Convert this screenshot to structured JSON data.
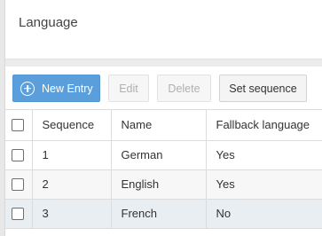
{
  "header": {
    "title": "Language"
  },
  "toolbar": {
    "new_entry": "New Entry",
    "edit": "Edit",
    "delete": "Delete",
    "set_sequence": "Set sequence"
  },
  "table": {
    "columns": [
      "Sequence",
      "Name",
      "Fallback language"
    ],
    "rows": [
      {
        "sequence": "1",
        "name": "German",
        "fallback": "Yes"
      },
      {
        "sequence": "2",
        "name": "English",
        "fallback": "Yes"
      },
      {
        "sequence": "3",
        "name": "French",
        "fallback": "No"
      }
    ]
  },
  "colors": {
    "primary_button": "#5a9fdb",
    "selected_row": "#e9eef3"
  }
}
